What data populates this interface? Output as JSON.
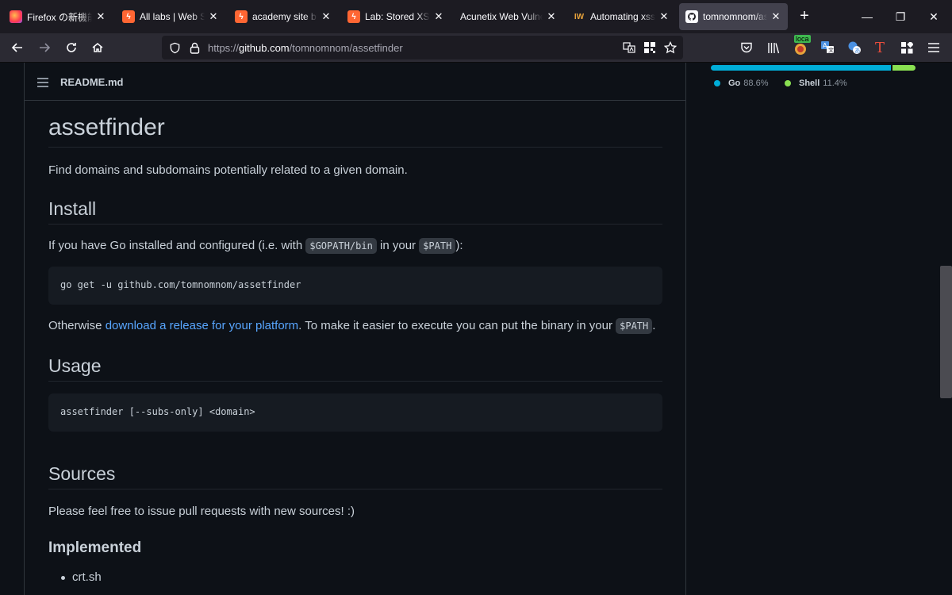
{
  "tabs": [
    {
      "title": "Firefox の新機能 - ",
      "icon": "firefox-icon"
    },
    {
      "title": "All labs | Web Secu",
      "icon": "portswigger-icon"
    },
    {
      "title": "academy site bugs",
      "icon": "portswigger-icon"
    },
    {
      "title": "Lab: Stored XSS int",
      "icon": "portswigger-icon"
    },
    {
      "title": "Acunetix Web Vulnera",
      "icon": ""
    },
    {
      "title": "Automating xss id",
      "icon": "iw-icon",
      "icon_text": "IW"
    },
    {
      "title": "tomnomnom/assetf",
      "icon": "github-icon",
      "active": true
    }
  ],
  "url": {
    "prefix": "https://",
    "host": "github.com",
    "path": "/tomnomnom/assetfinder"
  },
  "extensions": {
    "localhost_badge": "loca"
  },
  "readme": {
    "filename": "README.md",
    "title": "assetfinder",
    "description": "Find domains and subdomains potentially related to a given domain.",
    "install": {
      "heading": "Install",
      "text_before": "If you have Go installed and configured (i.e. with ",
      "code1": "$GOPATH/bin",
      "text_middle": " in your ",
      "code2": "$PATH",
      "text_after": "):",
      "command": "go get -u github.com/tomnomnom/assetfinder",
      "otherwise_before": "Otherwise ",
      "otherwise_link": "download a release for your platform",
      "otherwise_after": ". To make it easier to execute you can put the binary in your ",
      "otherwise_code": "$PATH",
      "otherwise_end": "."
    },
    "usage": {
      "heading": "Usage",
      "command": "assetfinder [--subs-only] <domain>"
    },
    "sources": {
      "heading": "Sources",
      "text": "Please feel free to issue pull requests with new sources! :)"
    },
    "implemented": {
      "heading": "Implemented",
      "items": [
        "crt.sh"
      ]
    }
  },
  "languages": [
    {
      "name": "Go",
      "percent": "88.6%",
      "value": 88.6,
      "color": "#00add8"
    },
    {
      "name": "Shell",
      "percent": "11.4%",
      "value": 11.4,
      "color": "#89e051"
    }
  ]
}
